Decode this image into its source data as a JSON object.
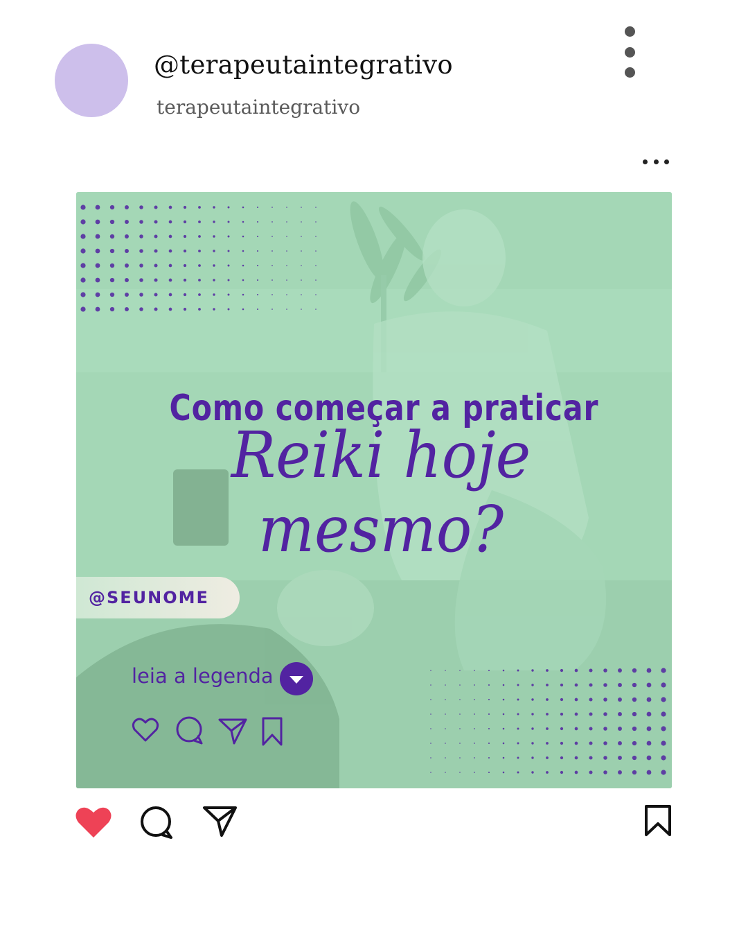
{
  "profile": {
    "handle": "@terapeutaintegrativo",
    "name": "terapeutaintegrativo",
    "avatar_color": "#cdbfeb"
  },
  "post": {
    "headline_line1": "Como começar a praticar",
    "headline_line2": "Reiki hoje mesmo?",
    "tag": "@SEUNOME",
    "cta": "leia a legenda",
    "accent_color": "#5223a1",
    "overlay_color": "#a4d7b6"
  },
  "actions": {
    "like_icon": "heart-filled-icon",
    "like_color": "#ee4256",
    "comment_icon": "comment-icon",
    "share_icon": "send-icon",
    "save_icon": "bookmark-icon"
  }
}
